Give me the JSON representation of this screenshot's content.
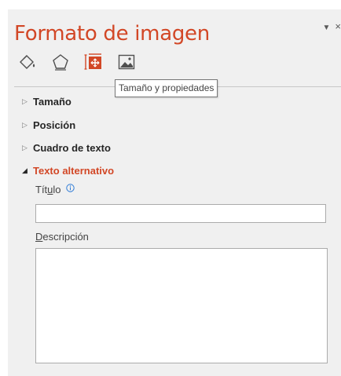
{
  "pane": {
    "title": "Formato de imagen",
    "tabs": [
      {
        "icon": "paint-bucket-icon",
        "name": "Relleno y línea"
      },
      {
        "icon": "pentagon-icon",
        "name": "Efectos"
      },
      {
        "icon": "size-properties-icon",
        "name": "Tamaño y propiedades"
      },
      {
        "icon": "picture-icon",
        "name": "Imagen"
      }
    ],
    "active_tab": "Tamaño y propiedades",
    "tooltip": "Tamaño y propiedades",
    "accent_color": "#d24726"
  },
  "sections": {
    "size": "Tamaño",
    "position": "Posición",
    "textbox": "Cuadro de texto",
    "alt_text": "Texto alternativo"
  },
  "alt_text": {
    "title_label_pre": "Tít",
    "title_label_ul": "u",
    "title_label_post": "lo",
    "title_value": "",
    "description_label_ul": "D",
    "description_label_rest": "escripción",
    "description_value": ""
  }
}
